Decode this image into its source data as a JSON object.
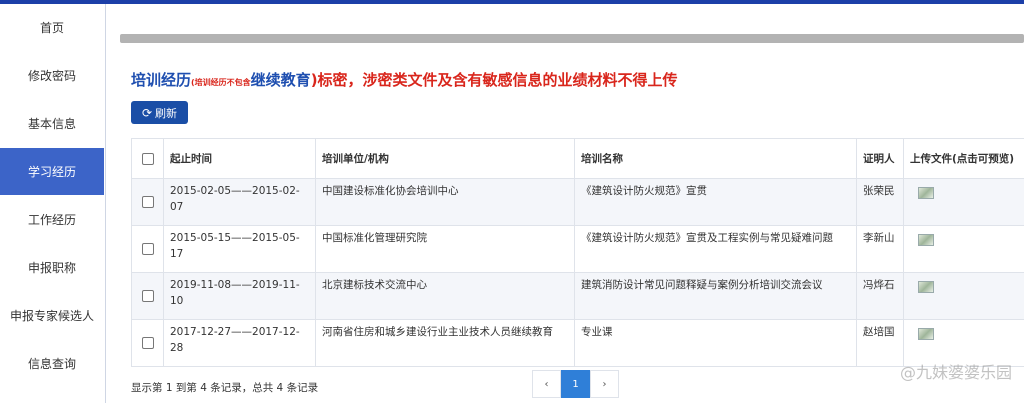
{
  "sidebar": {
    "items": [
      {
        "label": "首页"
      },
      {
        "label": "修改密码"
      },
      {
        "label": "基本信息"
      },
      {
        "label": "学习经历"
      },
      {
        "label": "工作经历"
      },
      {
        "label": "申报职称"
      },
      {
        "label": "申报专家候选人"
      },
      {
        "label": "信息查询"
      }
    ],
    "active_index": 3
  },
  "heading": {
    "part1": "培训经历",
    "part2": "(培训经历不包含",
    "part3": "继续教育",
    "part4": ")",
    "part5": "标密，涉密类文件及含有敏感信息的业绩材料不得上传"
  },
  "toolbar": {
    "refresh_label": "刷新",
    "refresh_icon": "refresh-icon"
  },
  "table": {
    "headers": [
      "起止时间",
      "培训单位/机构",
      "培训名称",
      "证明人",
      "上传文件(点击可预览)"
    ],
    "rows": [
      {
        "period": "2015-02-05——2015-02-07",
        "org": "中国建设标准化协会培训中心",
        "name": "《建筑设计防火规范》宣贯",
        "witness": "张荣民"
      },
      {
        "period": "2015-05-15——2015-05-17",
        "org": "中国标准化管理研究院",
        "name": "《建筑设计防火规范》宣贯及工程实例与常见疑难问题",
        "witness": "李新山"
      },
      {
        "period": "2019-11-08——2019-11-10",
        "org": "北京建标技术交流中心",
        "name": "建筑消防设计常见问题释疑与案例分析培训交流会议",
        "witness": "冯烨石"
      },
      {
        "period": "2017-12-27——2017-12-28",
        "org": "河南省住房和城乡建设行业主业技术人员继续教育",
        "name": "专业课",
        "witness": "赵培国"
      }
    ]
  },
  "footer": {
    "summary": "显示第 1 到第 4 条记录，总共 4 条记录"
  },
  "pager": {
    "prev": "‹",
    "current": "1",
    "next": "›"
  },
  "watermark": "@九妹婆婆乐园",
  "colors": {
    "accent": "#1c3fa8",
    "active_nav": "#3c64c8",
    "highlight_red": "#d9261c",
    "page_active": "#2f7fd8"
  }
}
